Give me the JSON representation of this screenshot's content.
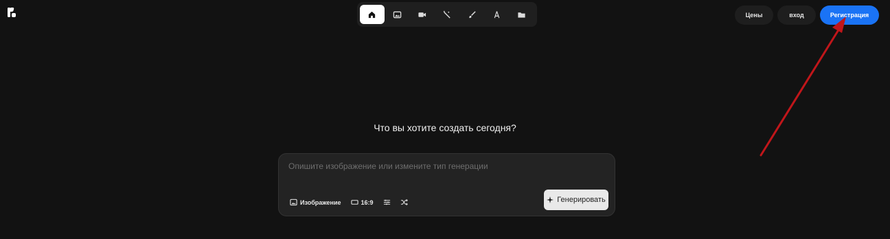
{
  "logo": {
    "icon": "k-logo-icon"
  },
  "toolbar": {
    "items": [
      {
        "icon": "home-icon",
        "active": true
      },
      {
        "icon": "image-icon",
        "active": false
      },
      {
        "icon": "video-icon",
        "active": false
      },
      {
        "icon": "magic-wand-icon",
        "active": false
      },
      {
        "icon": "brush-icon",
        "active": false
      },
      {
        "icon": "compass-icon",
        "active": false
      },
      {
        "icon": "folder-icon",
        "active": false
      }
    ]
  },
  "header": {
    "prices_label": "Цены",
    "login_label": "вход",
    "register_label": "Регистрация"
  },
  "main": {
    "heading": "Что вы хотите создать сегодня?"
  },
  "prompt": {
    "placeholder": "Опишите изображение или измените тип генерации",
    "value": "",
    "type_label": "Изображение",
    "aspect_label": "16:9",
    "generate_label": "Генерировать"
  },
  "colors": {
    "background": "#121212",
    "accent": "#1a73f5",
    "annotation_arrow": "#c0161a"
  }
}
